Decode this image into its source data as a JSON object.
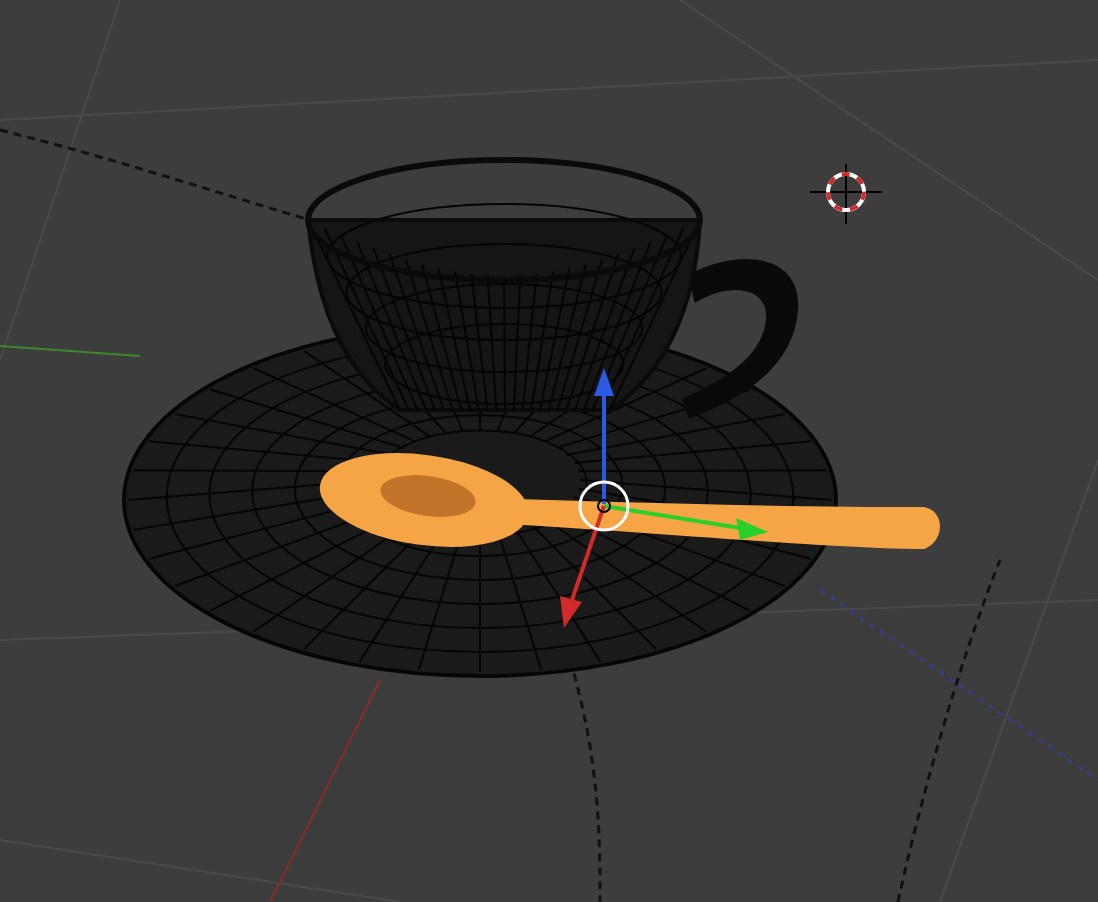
{
  "objects": [
    {
      "kind": "saucer",
      "selected": false
    },
    {
      "kind": "cup",
      "selected": false
    },
    {
      "kind": "spoon",
      "selected": true
    }
  ]
}
